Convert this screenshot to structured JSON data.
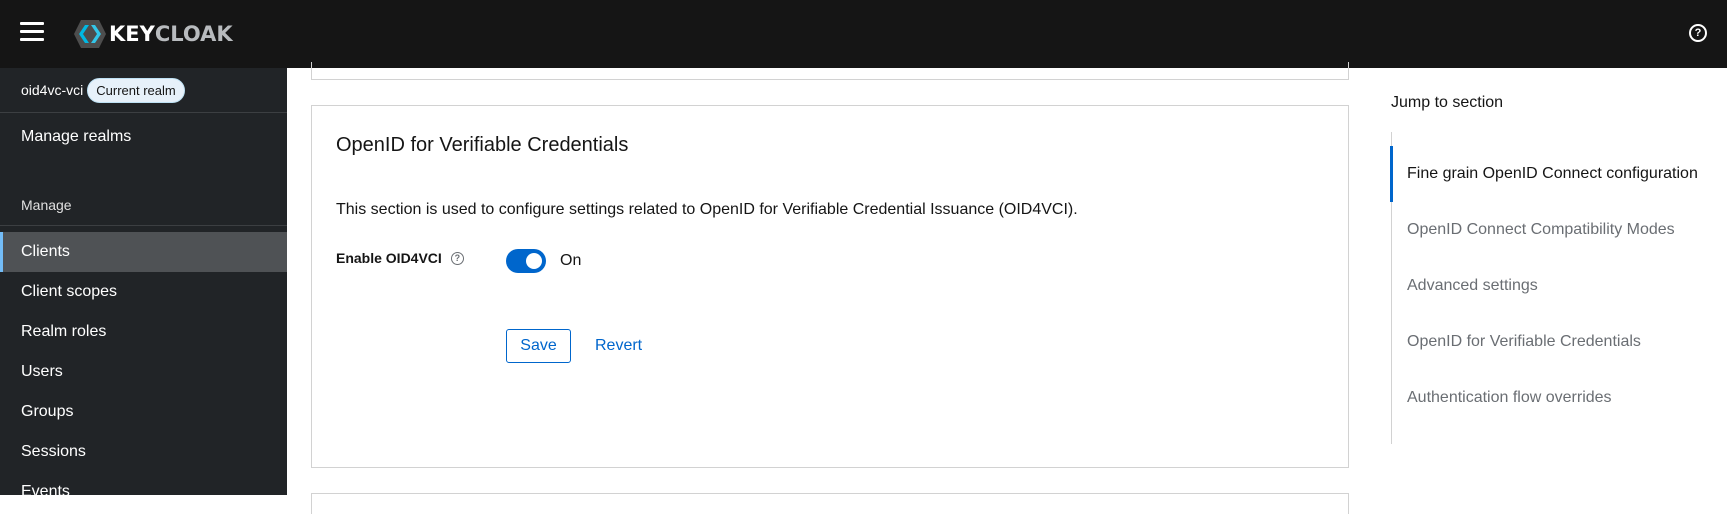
{
  "app": {
    "logo_text_primary": "KEY",
    "logo_text_secondary": "CLOAK"
  },
  "sidebar": {
    "realm_name": "oid4vc-vci",
    "realm_badge": "Current realm",
    "manage_realms": "Manage realms",
    "section_title": "Manage",
    "items": [
      {
        "label": "Clients",
        "active": true
      },
      {
        "label": "Client scopes"
      },
      {
        "label": "Realm roles"
      },
      {
        "label": "Users"
      },
      {
        "label": "Groups"
      },
      {
        "label": "Sessions"
      },
      {
        "label": "Events"
      }
    ]
  },
  "card": {
    "title": "OpenID for Verifiable Credentials",
    "description": "This section is used to configure settings related to OpenID for Verifiable Credential Issuance (OID4VCI).",
    "field_label": "Enable OID4VCI",
    "toggle_state": "On",
    "save_label": "Save",
    "revert_label": "Revert"
  },
  "jump": {
    "title": "Jump to section",
    "items": [
      {
        "label": "Fine grain OpenID Connect configuration",
        "active": true
      },
      {
        "label": "OpenID Connect Compatibility Modes"
      },
      {
        "label": "Advanced settings"
      },
      {
        "label": "OpenID for Verifiable Credentials"
      },
      {
        "label": "Authentication flow overrides"
      }
    ]
  },
  "colors": {
    "masthead": "#151515",
    "sidebar": "#212427",
    "accent": "#0066cc",
    "active_nav_border": "#73bcf7"
  }
}
